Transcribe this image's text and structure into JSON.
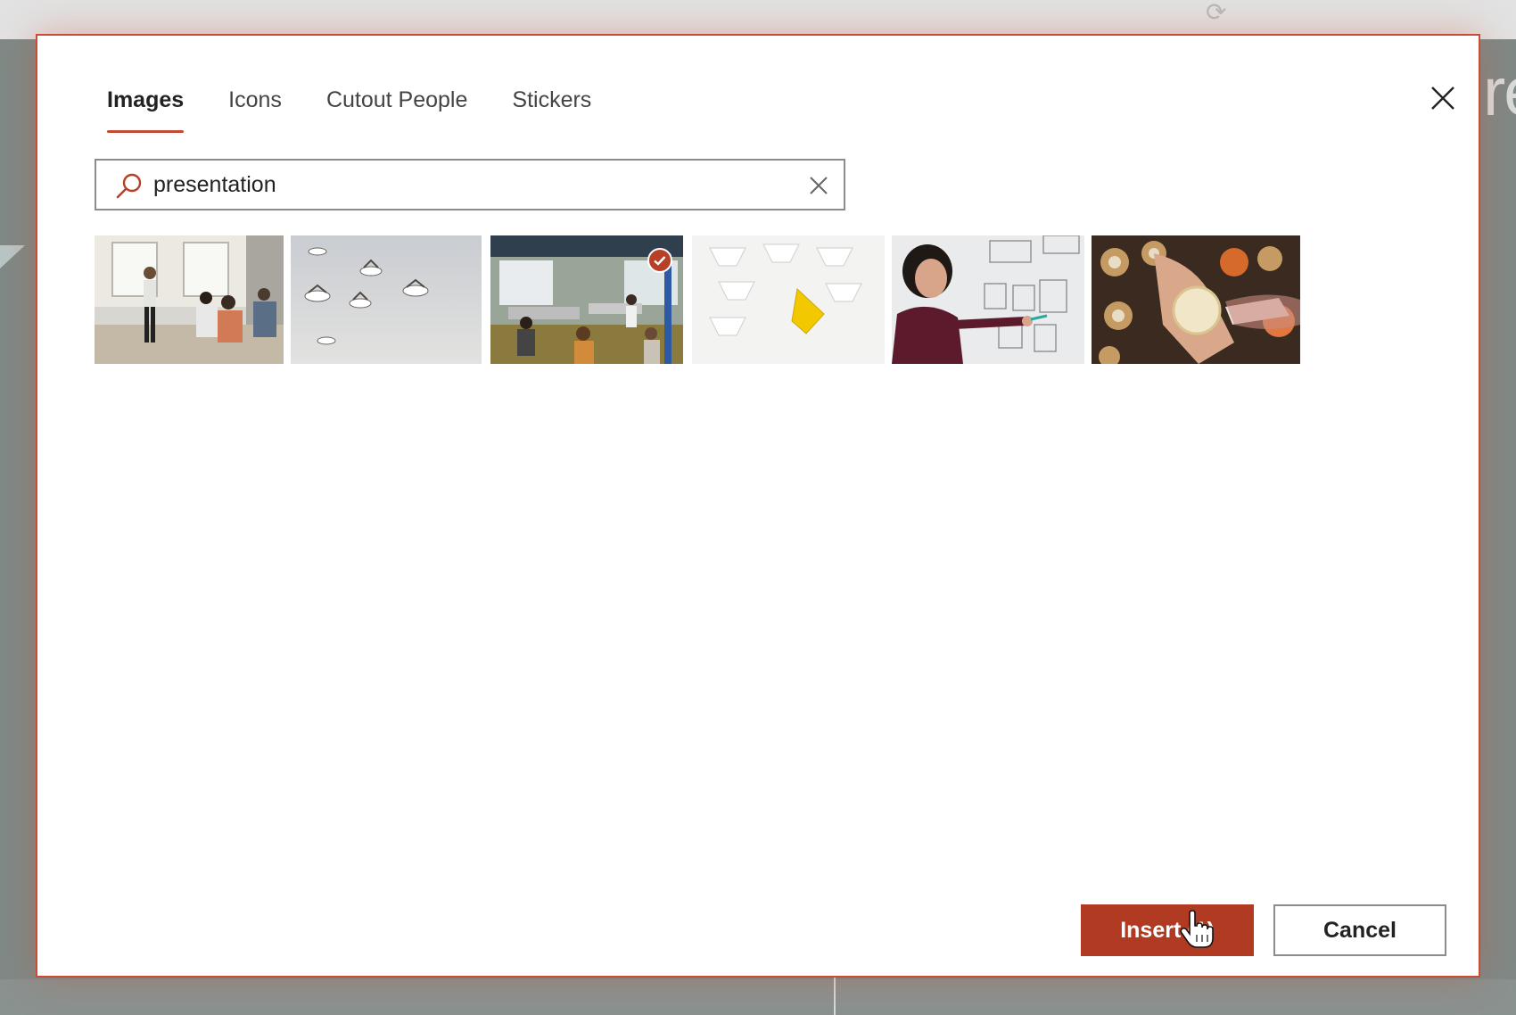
{
  "background": {
    "partial_text": "re"
  },
  "dialog": {
    "tabs": [
      {
        "label": "Images",
        "active": true
      },
      {
        "label": "Icons",
        "active": false
      },
      {
        "label": "Cutout People",
        "active": false
      },
      {
        "label": "Stickers",
        "active": false
      }
    ],
    "search": {
      "value": "presentation"
    },
    "results": [
      {
        "description": "woman presenting to seated group",
        "selected": false
      },
      {
        "description": "birds flying in grey sky",
        "selected": false
      },
      {
        "description": "open office team meeting",
        "selected": true
      },
      {
        "description": "white paper boats with one yellow",
        "selected": false
      },
      {
        "description": "woman at whiteboard",
        "selected": false
      },
      {
        "description": "decorating cupcakes",
        "selected": false
      }
    ],
    "buttons": {
      "insert": "Insert (1)",
      "cancel": "Cancel"
    }
  },
  "colors": {
    "accent": "#b03a22",
    "dialog_border": "#c94c37"
  }
}
